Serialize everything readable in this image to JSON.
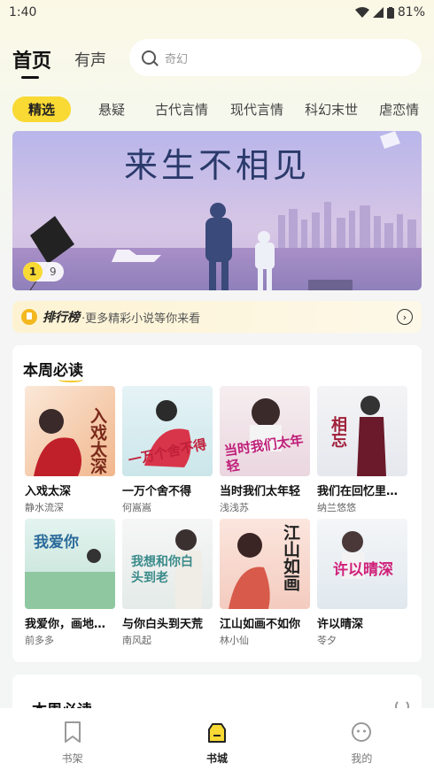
{
  "status": {
    "time": "1:40",
    "battery": "81%"
  },
  "nav": {
    "tab_home": "首页",
    "tab_audio": "有声"
  },
  "search": {
    "placeholder": "奇幻"
  },
  "categories": [
    "精选",
    "悬疑",
    "古代言情",
    "现代言情",
    "科幻末世",
    "虐恋情"
  ],
  "banner": {
    "title": "来生不相见",
    "current": "1",
    "total": "9"
  },
  "ranking": {
    "title": "排行榜",
    "subtitle": "·更多精彩小说等你来看"
  },
  "section1": {
    "title": "本周必读",
    "books": [
      {
        "title": "入戏太深",
        "author": "静水流深",
        "cover_text": "入戏太深"
      },
      {
        "title": "一万个舍不得",
        "author": "何嵩嵩",
        "cover_text": "一万个舍不得"
      },
      {
        "title": "当时我们太年轻",
        "author": "浅浅苏",
        "cover_text": "当时我们太年轻"
      },
      {
        "title": "我们在回忆里相...",
        "author": "纳兰悠悠",
        "cover_text": "相忘"
      },
      {
        "title": "我爱你，画地为...",
        "author": "前多多",
        "cover_text": "我爱你"
      },
      {
        "title": "与你白头到天荒",
        "author": "南风起",
        "cover_text": "我想和你白头到老"
      },
      {
        "title": "江山如画不如你",
        "author": "林小仙",
        "cover_text": "江山如画"
      },
      {
        "title": "许以晴深",
        "author": "苓夕",
        "cover_text": "许以晴深"
      }
    ]
  },
  "section2": {
    "title": "本周必读"
  },
  "tabbar": {
    "bookshelf": "书架",
    "bookstore": "书城",
    "mine": "我的"
  },
  "colors": {
    "accent": "#f9d934",
    "background": "#f4f5f4"
  }
}
